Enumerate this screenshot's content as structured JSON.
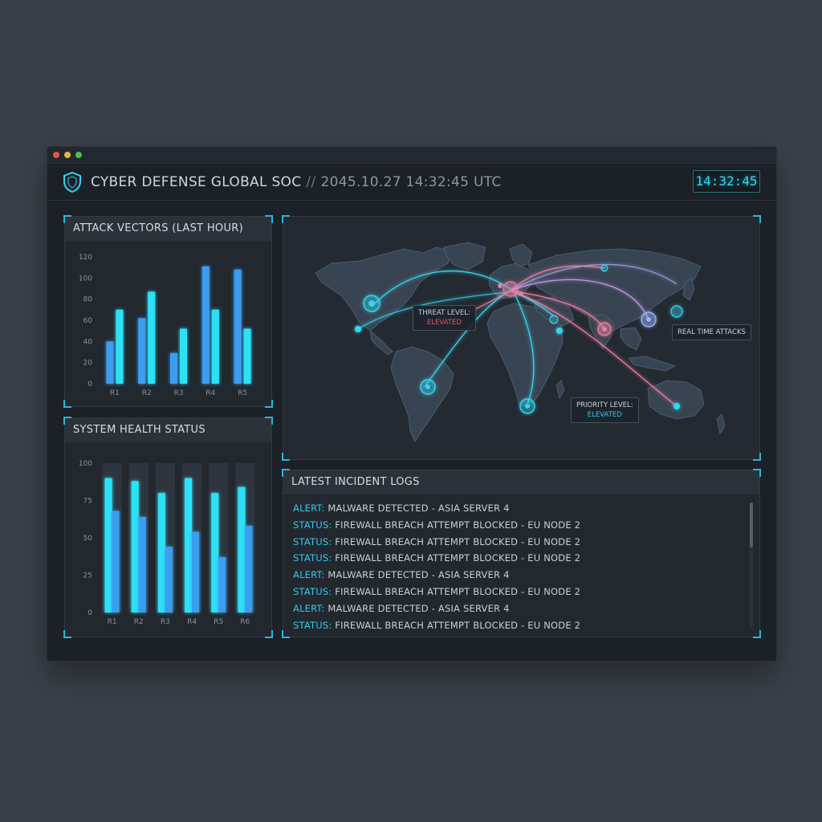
{
  "window": {
    "title": "CYBER DEFENSE GLOBAL SOC",
    "separator": "//",
    "timestamp": "2045.10.27 14:32:45 UTC",
    "clock": "14:32:45"
  },
  "attack_vectors": {
    "title": "ATTACK VECTORS (LAST HOUR)"
  },
  "system_health": {
    "title": "SYSTEM HEALTH STATUS"
  },
  "map": {
    "threat_label": "THREAT LEVEL:",
    "threat_value": "ELEVATED",
    "realtime_label": "REAL TIME ATTACKS",
    "priority_label": "PRIORITY LEVEL:",
    "priority_value": "ELEVATED"
  },
  "logs": {
    "title": "LATEST INCIDENT LOGS",
    "entries": [
      {
        "tag": "ALERT:",
        "text": " MALWARE DETECTED - ASIA SERVER 4",
        "kind": "alert"
      },
      {
        "tag": "STATUS:",
        "text": " FIREWALL BREACH ATTEMPT BLOCKED - EU NODE 2",
        "kind": "status"
      },
      {
        "tag": "STATUS:",
        "text": " FIREWALL BREACH ATTEMPT BLOCKED - EU NODE 2",
        "kind": "status"
      },
      {
        "tag": "STATUS:",
        "text": " FIREWALL BREACH ATTEMPT BLOCKED - EU NODE 2",
        "kind": "status"
      },
      {
        "tag": "ALERT:",
        "text": " MALWARE DETECTED - ASIA SERVER 4",
        "kind": "alert"
      },
      {
        "tag": "STATUS:",
        "text": " FIREWALL BREACH ATTEMPT BLOCKED - EU NODE 2",
        "kind": "status"
      },
      {
        "tag": "ALERT:",
        "text": " MALWARE DETECTED - ASIA SERVER 4",
        "kind": "alert"
      },
      {
        "tag": "STATUS:",
        "text": " FIREWALL BREACH ATTEMPT BLOCKED - EU NODE 2",
        "kind": "status"
      }
    ]
  },
  "colors": {
    "accent": "#2ab7d8",
    "bar_cyan": "#2fe0f5",
    "bar_blue": "#3a9ef0",
    "alert_red": "#e2566a"
  },
  "chart_data": [
    {
      "type": "bar",
      "categories": [
        "R1",
        "R2",
        "R3",
        "R4",
        "R5"
      ],
      "series": [
        {
          "values": [
            40,
            62,
            29,
            111,
            108
          ]
        },
        {
          "values": [
            70,
            87,
            52,
            70,
            52
          ]
        }
      ],
      "yticks": [
        0,
        20,
        40,
        60,
        80,
        100,
        120
      ],
      "ylim": [
        0,
        120
      ]
    },
    {
      "type": "bar",
      "categories": [
        "R1",
        "R2",
        "R3",
        "R4",
        "R5",
        "R6"
      ],
      "series": [
        {
          "values": [
            90,
            88,
            80,
            90,
            80,
            84
          ]
        },
        {
          "values": [
            68,
            64,
            44,
            54,
            37,
            58
          ]
        }
      ],
      "yticks": [
        0,
        25,
        50,
        75,
        100
      ],
      "ylim": [
        0,
        100
      ]
    }
  ]
}
